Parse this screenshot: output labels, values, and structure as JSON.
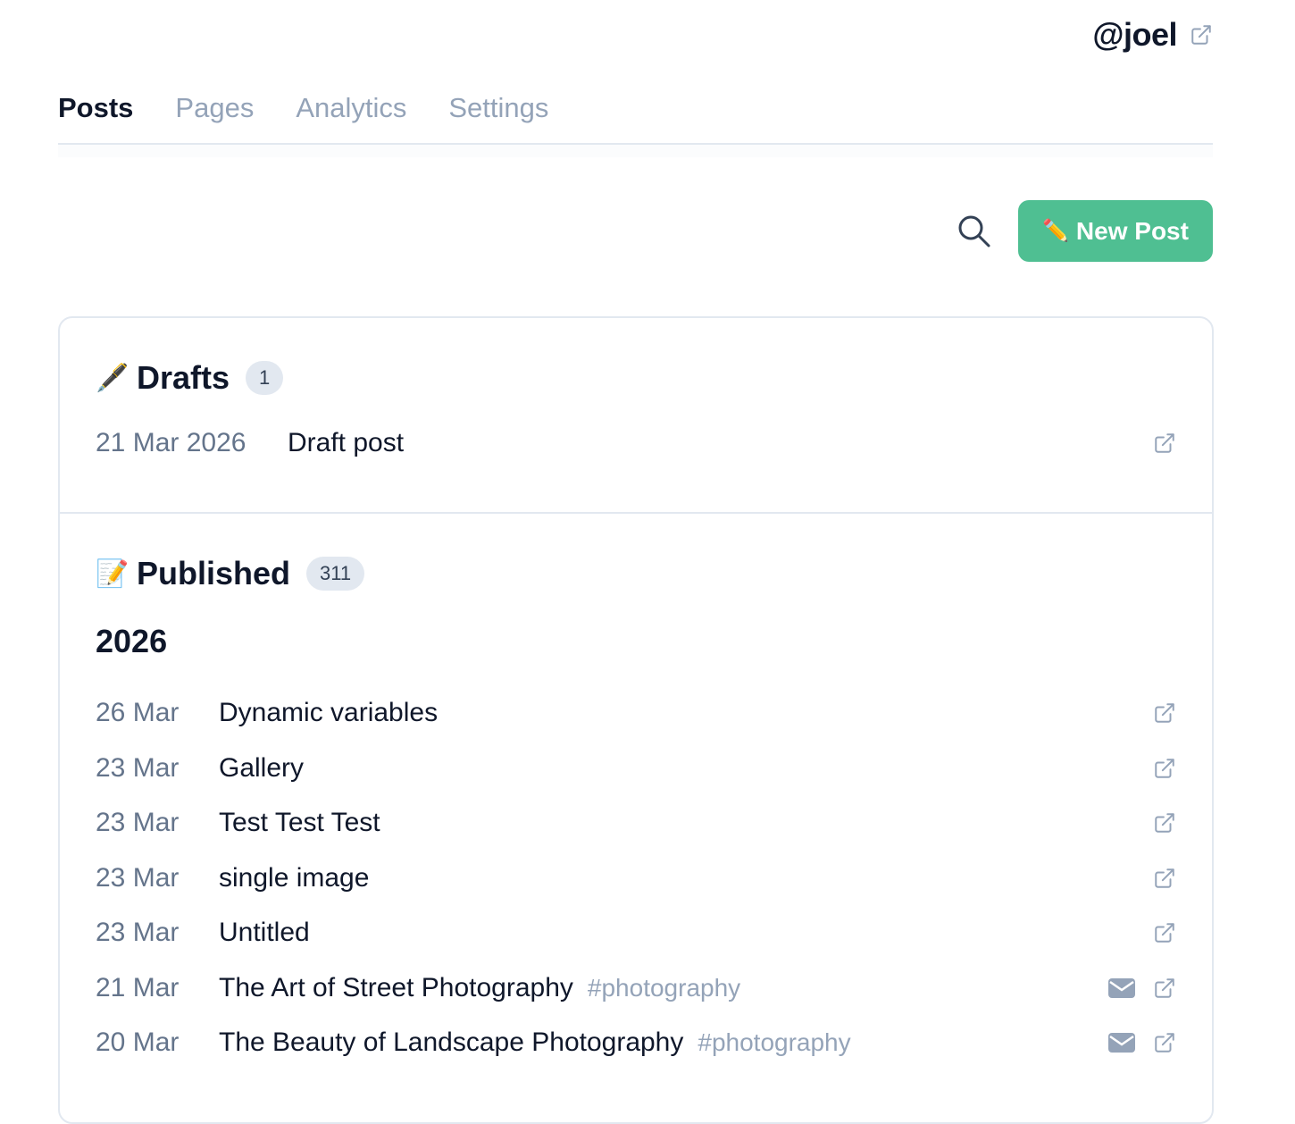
{
  "user": {
    "handle": "@joel"
  },
  "tabs": [
    {
      "label": "Posts",
      "active": true
    },
    {
      "label": "Pages",
      "active": false
    },
    {
      "label": "Analytics",
      "active": false
    },
    {
      "label": "Settings",
      "active": false
    }
  ],
  "toolbar": {
    "new_post_label": "New Post",
    "new_post_icon": "✏️"
  },
  "colors": {
    "accent": "#4fbf92"
  },
  "drafts": {
    "emoji": "🖋️",
    "title": "Drafts",
    "count": "1",
    "items": [
      {
        "date": "21 Mar 2026",
        "title": "Draft post"
      }
    ]
  },
  "published": {
    "emoji": "📝",
    "title": "Published",
    "count": "311",
    "year": "2026",
    "items": [
      {
        "date": "26 Mar",
        "title": "Dynamic variables"
      },
      {
        "date": "23 Mar",
        "title": "Gallery"
      },
      {
        "date": "23 Mar",
        "title": "Test Test Test"
      },
      {
        "date": "23 Mar",
        "title": "single image"
      },
      {
        "date": "23 Mar",
        "title": "Untitled"
      },
      {
        "date": "21 Mar",
        "title": "The Art of Street Photography",
        "tag": "#photography",
        "emailed": true
      },
      {
        "date": "20 Mar",
        "title": "The Beauty of Landscape Photography",
        "tag": "#photography",
        "emailed": true
      }
    ]
  }
}
